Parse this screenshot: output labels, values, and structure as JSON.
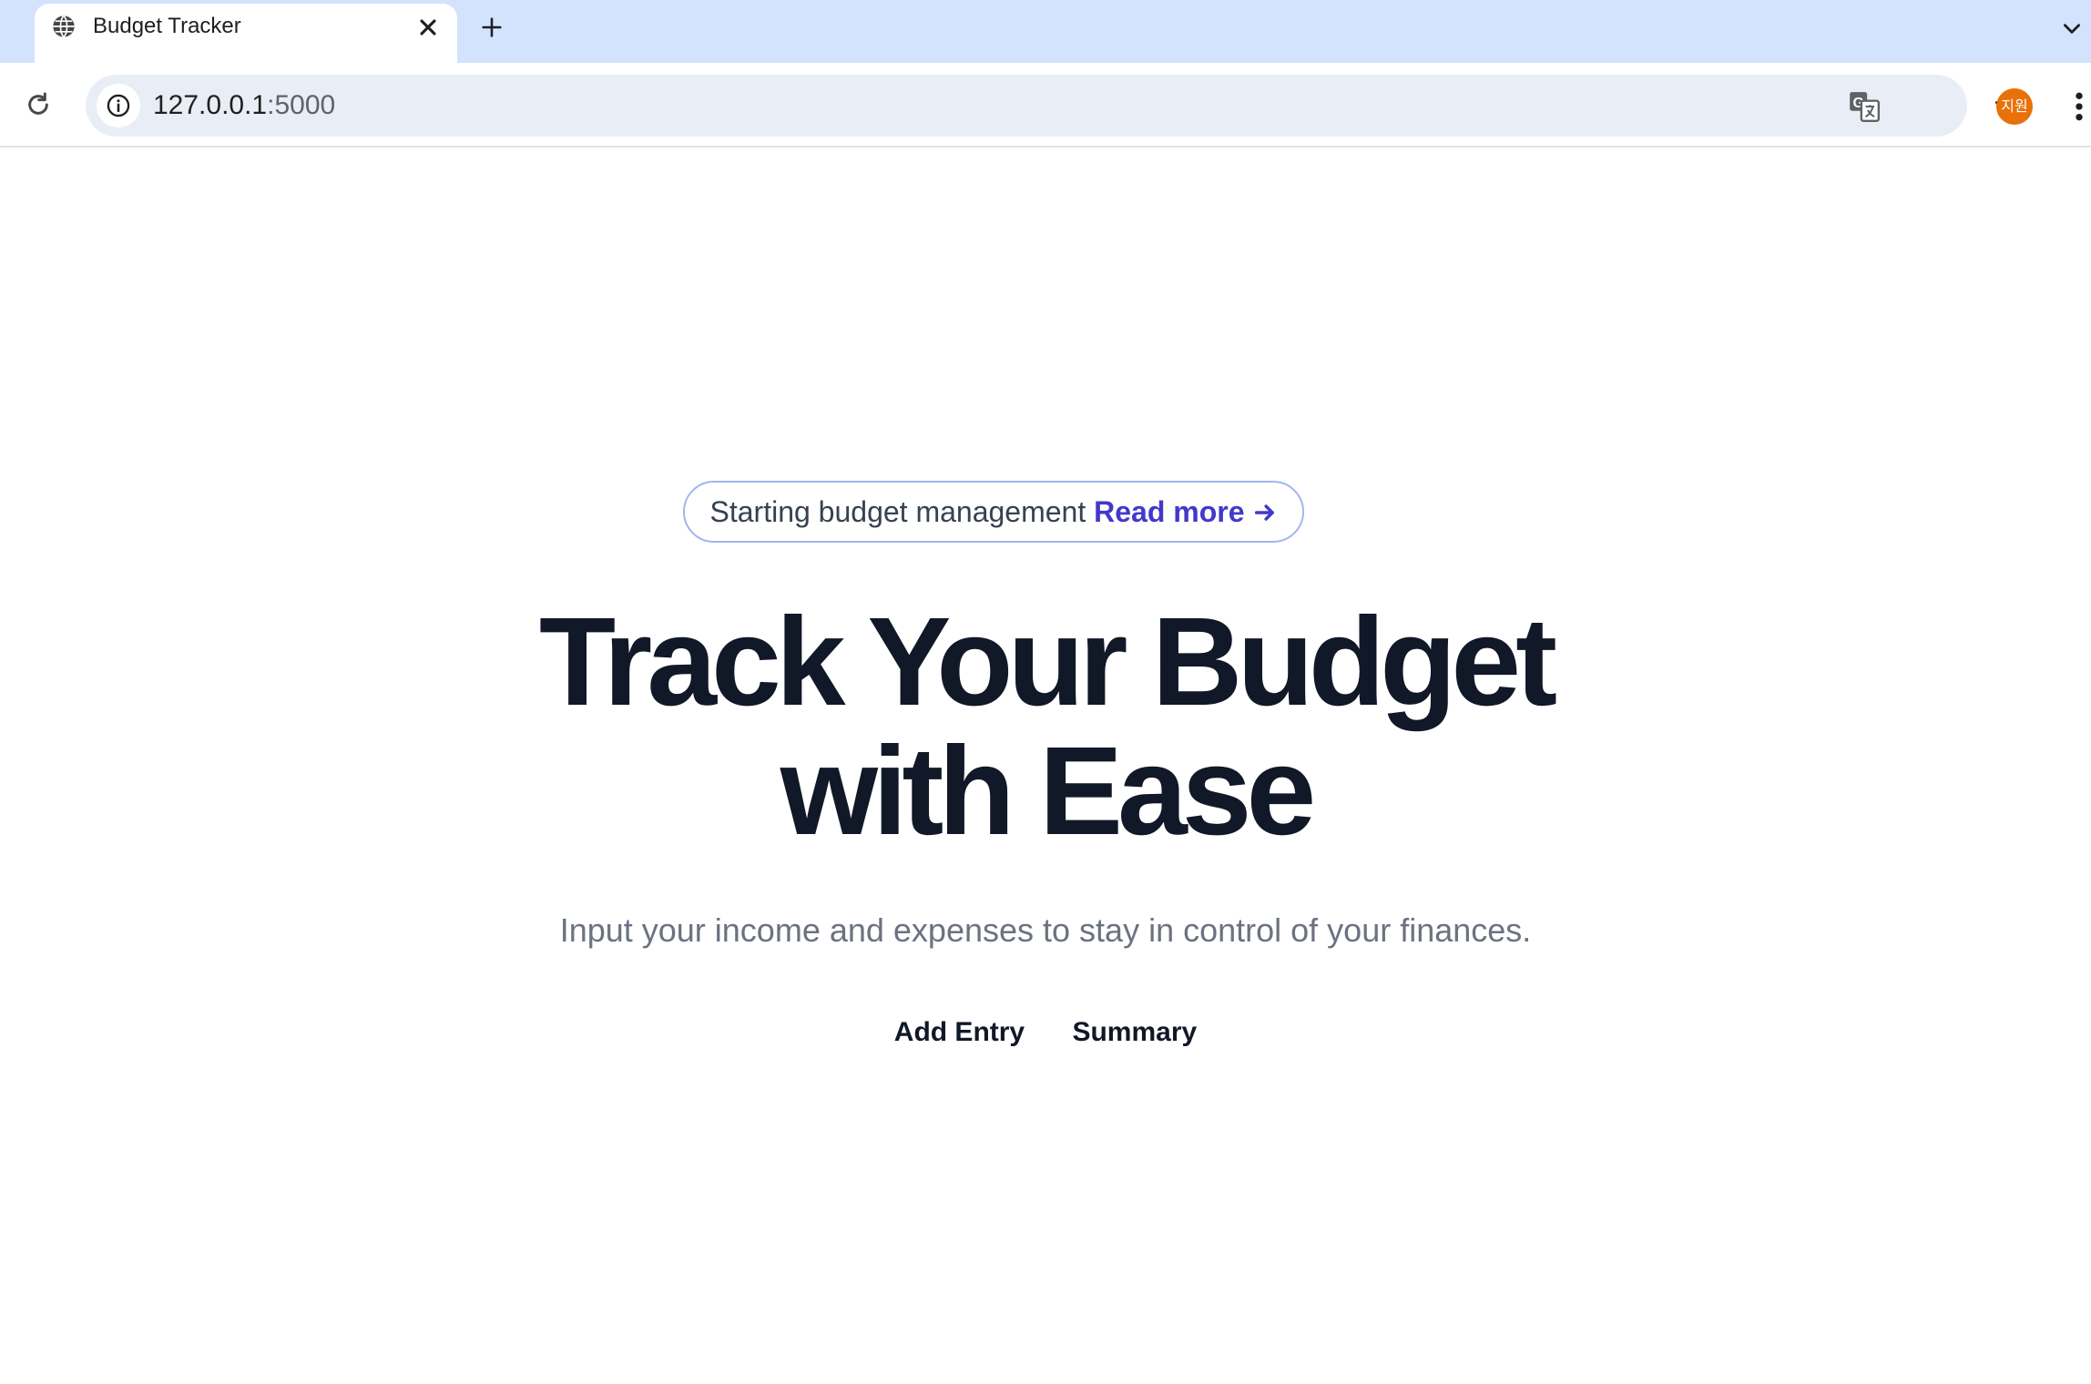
{
  "browser": {
    "tab": {
      "title": "Budget Tracker",
      "favicon": "globe-icon",
      "close_icon": "close-icon"
    },
    "new_tab_icon": "plus-icon",
    "tab_search_icon": "chevron-down-icon",
    "reload_icon": "reload-icon",
    "address_bar": {
      "site_info_icon": "info-icon",
      "url_host": "127.0.0.1",
      "url_port": ":5000",
      "translate_icon": "translate-icon",
      "bookmark_icon": "star-icon"
    },
    "profile": {
      "initials": "지원",
      "color": "#e8710a"
    },
    "menu_icon": "more-vertical-icon"
  },
  "hero": {
    "announcement": {
      "text": "Starting budget management",
      "link_label": "Read more",
      "arrow_icon": "arrow-right-icon"
    },
    "title_line1": "Track Your Budget",
    "title_line2": "with Ease",
    "subtitle": "Input your income and expenses to stay in control of your finances.",
    "actions": {
      "add_entry": "Add Entry",
      "summary": "Summary"
    }
  },
  "colors": {
    "tabstrip": "#d3e3fd",
    "omnibox": "#e9eef6",
    "heading": "#111827",
    "subtitle": "#6b7280",
    "link": "#4338ca",
    "pill_border": "#9fb8ec"
  }
}
